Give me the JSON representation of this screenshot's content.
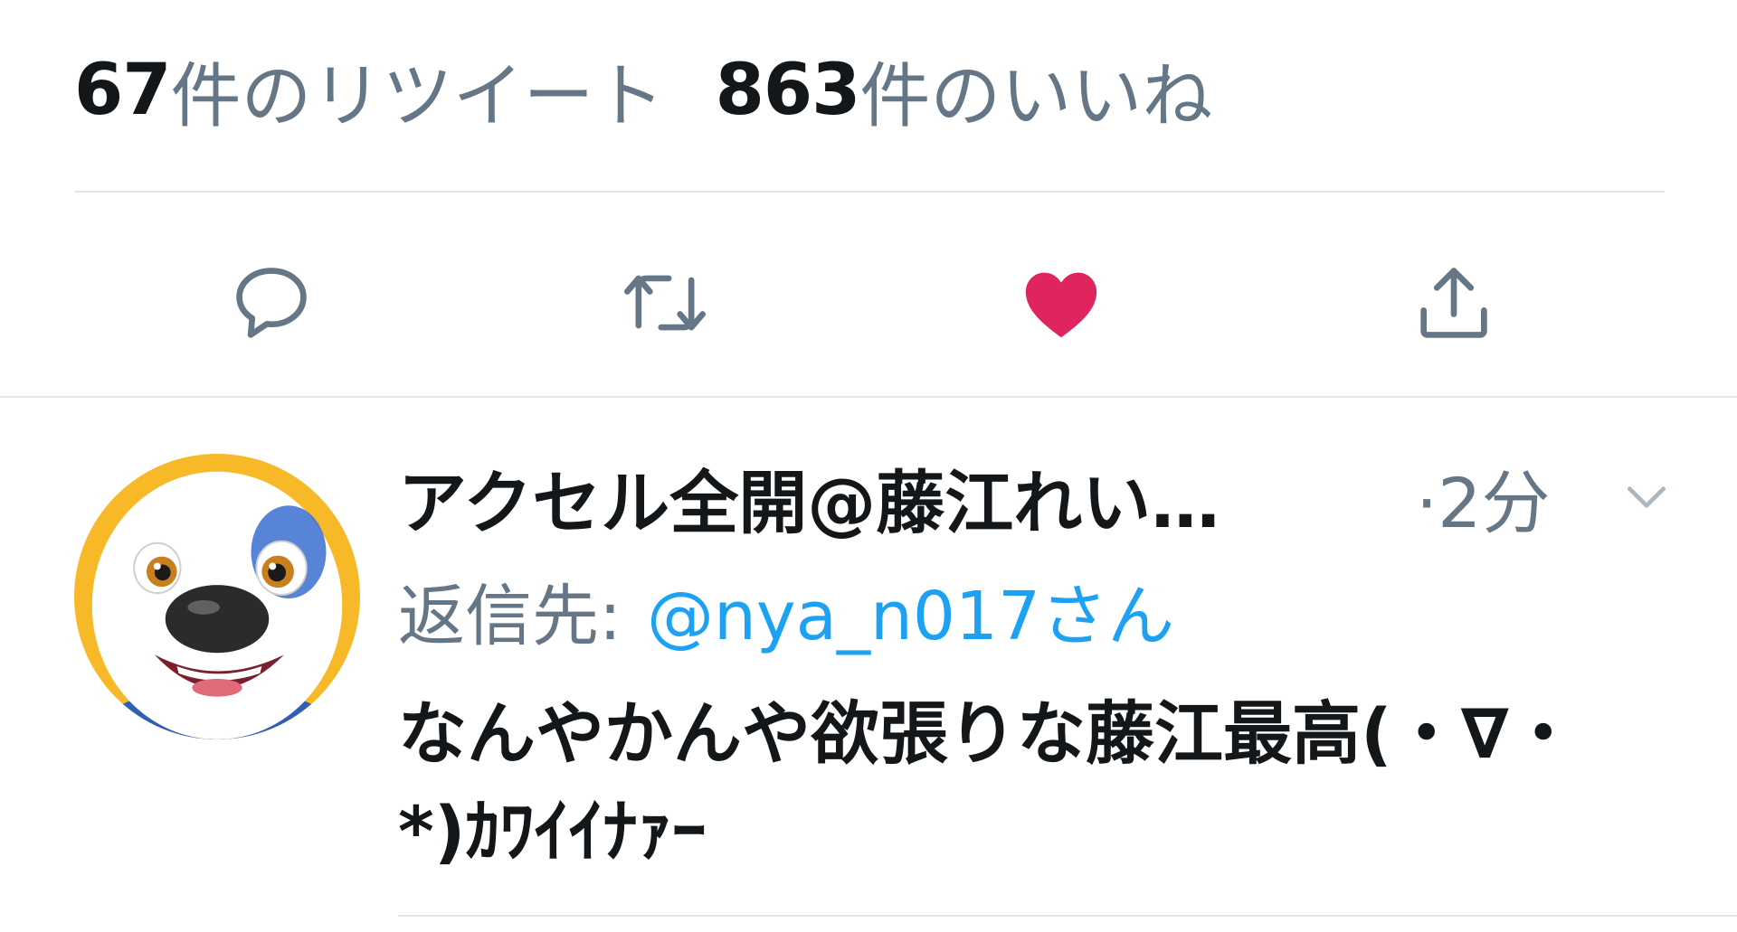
{
  "stats": {
    "retweet_count": "67",
    "retweet_label": "件のリツイート",
    "like_count": "863",
    "like_label": "件のいいね"
  },
  "actions": {
    "reply_icon": "reply-icon",
    "retweet_icon": "retweet-icon",
    "like_icon": "heart-icon",
    "share_icon": "share-icon",
    "liked": true,
    "like_color": "#e0245e",
    "icon_color": "#657786"
  },
  "reply_tweet": {
    "display_name": "アクセル全開@藤江れい…",
    "time": "·2分",
    "reply_prefix": "返信先:",
    "reply_handle": "@nya_n017さん",
    "text": "なんやかんや欲張りな藤江最高(・∇・*)ｶﾜｲｲﾅｧｰ",
    "link_color": "#1da1f2",
    "secondary_color": "#657786"
  }
}
